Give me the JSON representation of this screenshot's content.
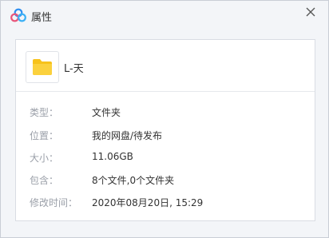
{
  "window": {
    "title": "属性",
    "title_icon": "baidu-netdisk-logo-icon",
    "close_icon": "close-icon"
  },
  "file": {
    "icon": "folder-icon",
    "name": "L-天"
  },
  "properties": [
    {
      "label": "类型：",
      "value": "文件夹"
    },
    {
      "label": "位置：",
      "value": "我的网盘/待发布"
    },
    {
      "label": "大小：",
      "value": "11.06GB"
    },
    {
      "label": "包含：",
      "value": "8个文件,0个文件夹"
    },
    {
      "label": "修改时间：",
      "value": "2020年08月20日, 15:29"
    }
  ],
  "colors": {
    "folder": "#f7c21b",
    "logo_blue": "#2e8ef0",
    "logo_pink": "#e8557a"
  }
}
